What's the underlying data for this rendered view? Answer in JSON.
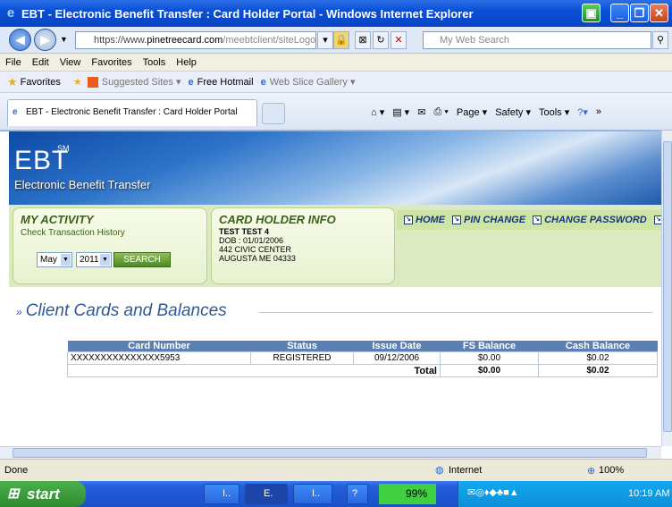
{
  "window": {
    "title": "EBT - Electronic Benefit Transfer : Card Holder Portal - Windows Internet Explorer"
  },
  "address": {
    "url_prefix": "https://www.",
    "url_domain": "pinetreecard.com",
    "url_path": "/meebtclient/siteLogon",
    "search_placeholder": "My Web Search"
  },
  "menu": [
    "File",
    "Edit",
    "View",
    "Favorites",
    "Tools",
    "Help"
  ],
  "favorites": {
    "label": "Favorites",
    "items": [
      "Suggested Sites ▾",
      "Free Hotmail",
      "Web Slice Gallery ▾"
    ]
  },
  "tab": {
    "label": "EBT - Electronic Benefit Transfer : Card Holder Portal"
  },
  "commandbar": {
    "page": "Page ▾",
    "safety": "Safety ▾",
    "tools": "Tools ▾"
  },
  "header": {
    "logo": "EBT",
    "sm": "SM",
    "subtitle": "Electronic Benefit Transfer"
  },
  "activity": {
    "title": "MY ACTIVITY",
    "subtitle": "Check Transaction History",
    "month": "May",
    "year": "2011",
    "search": "SEARCH"
  },
  "cardholder": {
    "title": "CARD HOLDER INFO",
    "name": "TEST TEST 4",
    "dob": "DOB : 01/01/2006",
    "address1": "442 CIVIC CENTER",
    "address2": "AUGUSTA  ME 04333"
  },
  "links": {
    "home": "HOME",
    "pin": "PIN CHANGE",
    "password": "CHANGE PASSWORD"
  },
  "section": {
    "title": "Client Cards and Balances"
  },
  "table": {
    "headers": [
      "Card Number",
      "Status",
      "Issue Date",
      "FS Balance",
      "Cash Balance"
    ],
    "row": [
      "XXXXXXXXXXXXXXX5953",
      "REGISTERED",
      "09/12/2006",
      "$0.00",
      "$0.02"
    ],
    "total_label": "Total",
    "total_fs": "$0.00",
    "total_cash": "$0.02"
  },
  "status": {
    "left": "Done",
    "zone": "Internet",
    "zoom": "100%"
  },
  "taskbar": {
    "start": "start",
    "tasks": [
      "I..",
      "E.",
      "I..",
      "?"
    ],
    "battery": "99%",
    "clock": "10:19 AM"
  }
}
